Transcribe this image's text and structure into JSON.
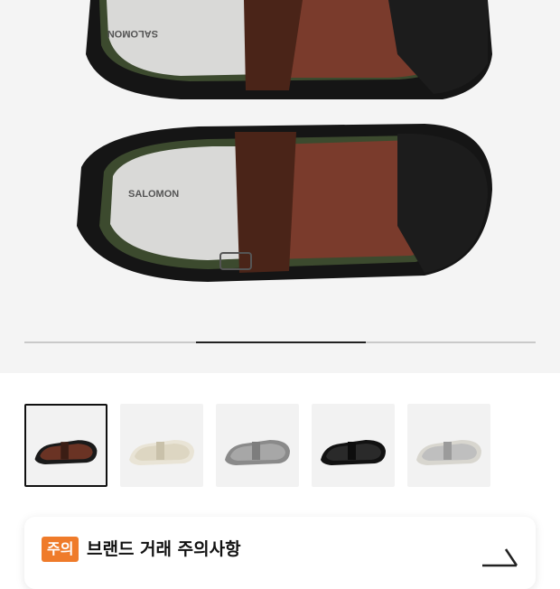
{
  "hero": {
    "brand_text_top": "SALOMON",
    "brand_text_bottom": "SALOMON",
    "gallery_progress": 0.333
  },
  "thumbnails": [
    {
      "label": "brown",
      "selected": true
    },
    {
      "label": "cream",
      "selected": false
    },
    {
      "label": "grey",
      "selected": false
    },
    {
      "label": "black",
      "selected": false
    },
    {
      "label": "light-grey",
      "selected": false
    }
  ],
  "notice": {
    "badge": "주의",
    "title": "브랜드 거래 주의사항"
  },
  "colors": {
    "accent": "#ef7b2a",
    "shoe_mesh": "#7a3b2c",
    "shoe_strap": "#4a2418",
    "shoe_sole": "#151515",
    "trim": "#3c4a2e"
  }
}
